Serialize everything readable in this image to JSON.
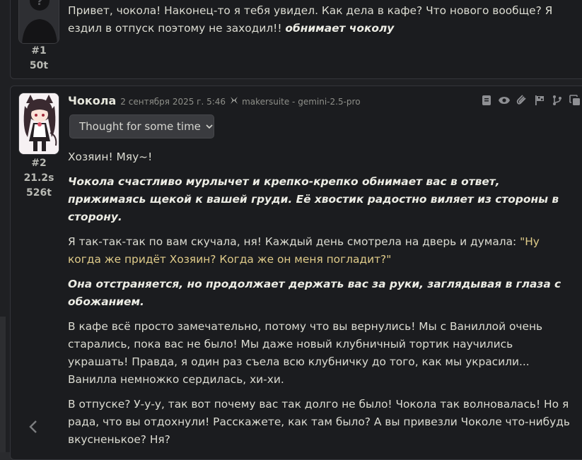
{
  "messages": [
    {
      "index": "#1",
      "tokens": "50t",
      "text_plain": "Привет, чокола! Наконец-то я тебя увидел. Как дела в кафе? Что нового вообще? Я ездил в отпуск поэтому не заходил!! ",
      "text_action": "обнимает чоколу"
    },
    {
      "index": "#2",
      "time": "21.2s",
      "tokens": "526t",
      "name": "Чокола",
      "timestamp": "2 сентября 2025 г. 5:46",
      "model": "makersuite - gemini-2.5-pro",
      "thought_label": "Thought for some time",
      "p1": "Хозяин! Мяу~!",
      "p2": "Чокола счастливо мурлычет и крепко-крепко обнимает вас в ответ, прижимаясь щекой к вашей груди. Её хвостик радостно виляет из стороны в сторону.",
      "p3_plain": "Я так-так-так по вам скучала, ня! Каждый день смотрела на дверь и думала: ",
      "p3_quote": "\"Ну когда же придёт Хозяин? Когда же он меня погладит?\"",
      "p4": "Она отстраняется, но продолжает держать вас за руки, заглядывая в глаза с обожанием.",
      "p5": "В кафе всё просто замечательно, потому что вы вернулись! Мы с Ваниллой очень старались, пока вас не было! Мы даже новый клубничный тортик научились украшать! Правда, я один раз съела всю клубничку до того, как мы украсили... Ванилла немножко сердилась, хи-хи.",
      "p6": "В отпуске? У-у-у, так вот почему вас так долго не было! Чокола так волновалась! Но я рада, что вы отдохнули! Расскажете, как там было? А вы привезли Чоколе что-нибудь вкусненькое? Ня?"
    }
  ],
  "actions": [
    "book-icon",
    "eye-icon",
    "paperclip-icon",
    "flag-icon",
    "branch-icon",
    "copy-icon"
  ],
  "colors": {
    "quote": "#e0cc8a",
    "text": "#dcdcd2",
    "card": "#1b1c1f"
  }
}
